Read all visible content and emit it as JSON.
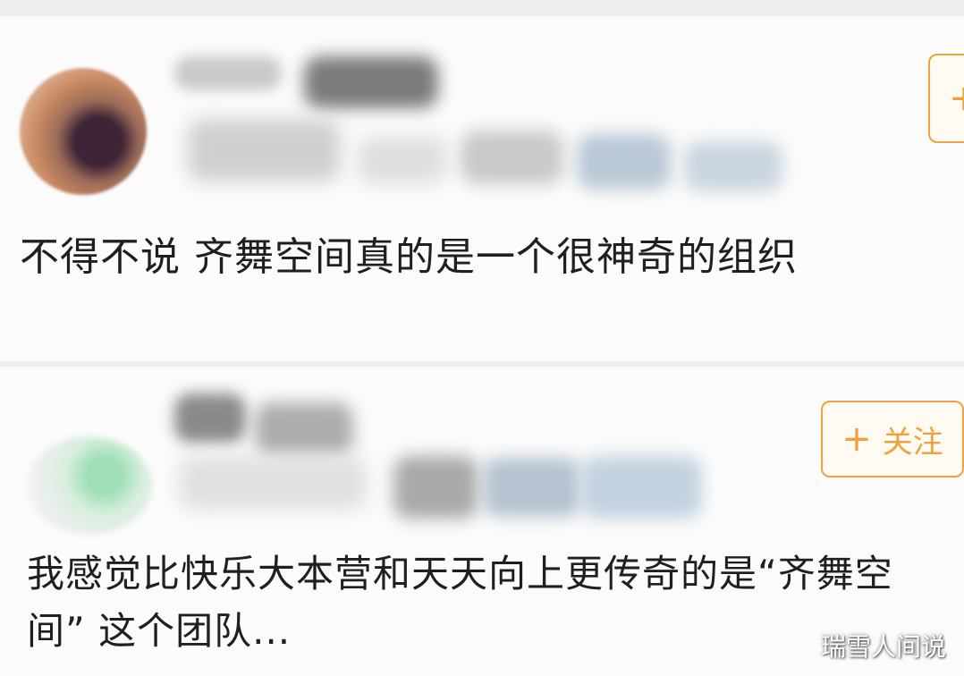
{
  "posts": [
    {
      "comment": "不得不说 齐舞空间真的是一个很神奇的组织"
    },
    {
      "follow_label": "关注",
      "comment": "我感觉比快乐大本营和天天向上更传奇的是“齐舞空间” 这个团队..."
    }
  ],
  "follow_icon": "+",
  "watermark": "瑞雪人间说",
  "colors": {
    "accent": "#f0a23c",
    "text": "#1f1f1f",
    "card_bg": "#fbfbfb",
    "page_bg": "#ededed"
  }
}
